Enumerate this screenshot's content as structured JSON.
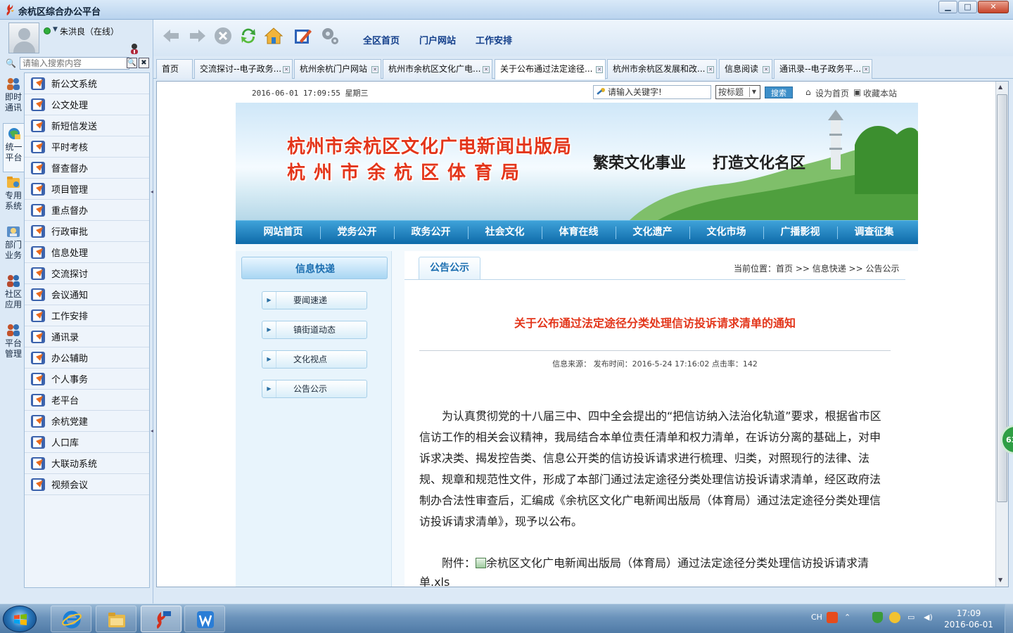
{
  "window": {
    "title": "余杭区综合办公平台",
    "min": "▁",
    "max": "□",
    "close": "✕"
  },
  "user": {
    "name": "朱洪良（在线）"
  },
  "left_search": {
    "placeholder": "请输入搜索内容",
    "search_btn": "🔍",
    "clear_btn": "✖"
  },
  "vtabs": [
    {
      "label": "即时通讯"
    },
    {
      "label": "统一平台"
    },
    {
      "label": "专用系统"
    },
    {
      "label": "部门业务"
    },
    {
      "label": "社区应用"
    },
    {
      "label": "平台管理"
    }
  ],
  "menu": [
    {
      "label": "新公文系统"
    },
    {
      "label": "公文处理"
    },
    {
      "label": "新短信发送"
    },
    {
      "label": "平时考核"
    },
    {
      "label": "督查督办"
    },
    {
      "label": "项目管理"
    },
    {
      "label": "重点督办"
    },
    {
      "label": "行政审批"
    },
    {
      "label": "信息处理"
    },
    {
      "label": "交流探讨"
    },
    {
      "label": "会议通知"
    },
    {
      "label": "工作安排"
    },
    {
      "label": "通讯录"
    },
    {
      "label": "办公辅助"
    },
    {
      "label": "个人事务"
    },
    {
      "label": "老平台"
    },
    {
      "label": "余杭党建"
    },
    {
      "label": "人口库"
    },
    {
      "label": "大联动系统"
    },
    {
      "label": "视频会议"
    }
  ],
  "toolbar": {
    "icons": [
      "back-icon",
      "forward-icon",
      "stop-icon",
      "refresh-icon",
      "home-icon",
      "edit-icon",
      "settings-icon"
    ],
    "links": [
      "全区首页",
      "门户网站",
      "工作安排"
    ]
  },
  "tabs": [
    {
      "label": "首页"
    },
    {
      "label": "交流探讨--电子政务..."
    },
    {
      "label": "杭州余杭门户网站"
    },
    {
      "label": "杭州市余杭区文化广电..."
    },
    {
      "label": "关于公布通过法定途径..."
    },
    {
      "label": "杭州市余杭区发展和改..."
    },
    {
      "label": "信息阅读"
    },
    {
      "label": "通讯录--电子政务平..."
    }
  ],
  "site": {
    "datetime": "2016-06-01 17:09:55 星期三",
    "keyword_placeholder": "请输入关键字!",
    "search_mode": "按标题",
    "search_btn": "搜索",
    "set_home": "设为首页",
    "bookmark": "收藏本站",
    "banner_title1": "杭州市余杭区文化广电新闻出版局",
    "banner_title2": "杭州市余杭区体育局",
    "slogan1": "繁荣文化事业",
    "slogan2": "打造文化名区",
    "nav": [
      "网站首页",
      "党务公开",
      "政务公开",
      "社会文化",
      "体育在线",
      "文化遗产",
      "文化市场",
      "广播影视",
      "调查征集"
    ],
    "side_head": "信息快递",
    "side_links": [
      "要闻速递",
      "镇街道动态",
      "文化视点",
      "公告公示"
    ],
    "section": "公告公示",
    "breadcrumb": "当前位置：首页 >> 信息快递 >> 公告公示",
    "article_title": "关于公布通过法定途径分类处理信访投诉请求清单的通知",
    "article_meta": "信息来源： 发布时间：2016-5-24 17:16:02 点击率：142",
    "article_body": "为认真贯彻党的十八届三中、四中全会提出的“把信访纳入法治化轨道”要求，根据省市区信访工作的相关会议精神，我局结合本单位责任清单和权力清单，在诉访分离的基础上，对申诉求决类、揭发控告类、信息公开类的信访投诉请求进行梳理、归类，对照现行的法律、法规、规章和规范性文件，形成了本部门通过法定途径分类处理信访投诉请求清单，经区政府法制办合法性审查后，汇编成《余杭区文化广电新闻出版局（体育局）通过法定途径分类处理信访投诉请求清单》，现予以公布。",
    "attach_label": "附件：",
    "attach_name": "余杭区文化广电新闻出版局（体育局）通过法定途径分类处理信访投诉请求清单.xls"
  },
  "float_badge": "63",
  "taskbar": {
    "apps": [
      "ie-icon",
      "explorer-icon",
      "im-icon",
      "wps-icon"
    ],
    "lang": "CH",
    "time": "17:09",
    "date": "2016-06-01"
  },
  "colors": {
    "accent": "#1b6eb0",
    "title_red": "#e3361b",
    "nav_blue": "#0e6aa9"
  }
}
